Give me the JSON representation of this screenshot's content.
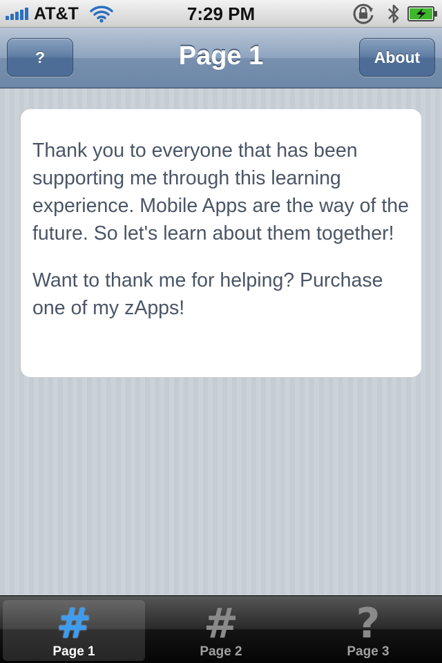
{
  "status_bar": {
    "carrier": "AT&T",
    "time": "7:29 PM",
    "icons": [
      "signal-icon",
      "wifi-icon",
      "rotation-lock-icon",
      "bluetooth-icon",
      "battery-charging-icon"
    ]
  },
  "nav_bar": {
    "title": "Page 1",
    "left_button": "?",
    "right_button": "About"
  },
  "content": {
    "paragraphs": [
      "Thank you to everyone that has been supporting me through this learning experience. Mobile Apps are the way of the future. So let's learn about them together!",
      "Want to thank me for helping? Purchase one of my zApps!"
    ]
  },
  "tab_bar": {
    "tabs": [
      {
        "icon": "#",
        "label": "Page 1",
        "selected": true
      },
      {
        "icon": "#",
        "label": "Page 2",
        "selected": false
      },
      {
        "icon": "?",
        "label": "Page 3",
        "selected": false
      }
    ]
  },
  "colors": {
    "nav_bar": "#6d87a8",
    "selected_tab_icon": "#3d9cf0",
    "body_text": "#4b5566"
  }
}
